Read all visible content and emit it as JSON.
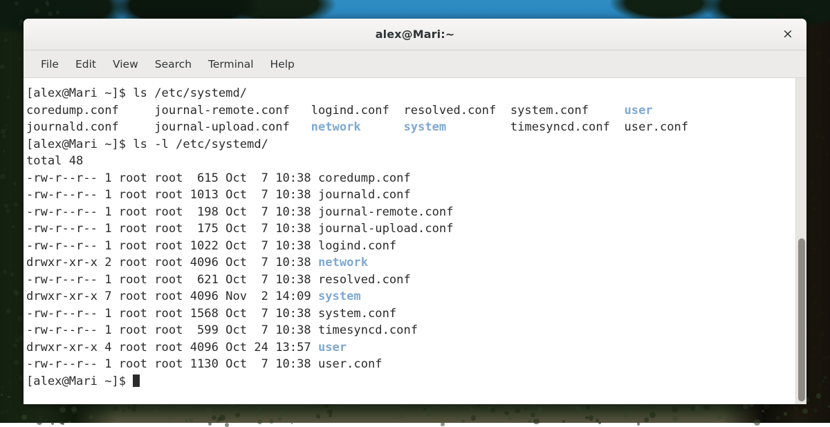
{
  "window": {
    "title": "alex@Mari:~",
    "close_label": "×"
  },
  "menubar": {
    "items": [
      {
        "label": "File"
      },
      {
        "label": "Edit"
      },
      {
        "label": "View"
      },
      {
        "label": "Search"
      },
      {
        "label": "Terminal"
      },
      {
        "label": "Help"
      }
    ]
  },
  "colors": {
    "directory_blue": "#7fa8d4",
    "foreground": "#2b2b2b",
    "background": "#ffffff",
    "titlebar": "#f1efee",
    "menubar": "#edebe9"
  },
  "terminal": {
    "prompt": "[alex@Mari ~]$ ",
    "commands": {
      "first": "ls /etc/systemd/",
      "second": "ls -l /etc/systemd/"
    },
    "ls_columns": {
      "row1": {
        "c1": "coredump.conf",
        "c2": "journal-remote.conf",
        "c3": "logind.conf",
        "c4": "resolved.conf",
        "c5": "system.conf",
        "c6": "user",
        "c6_is_dir": true
      },
      "row2": {
        "c1": "journald.conf",
        "c2": "journal-upload.conf",
        "c3": "network",
        "c3_is_dir": true,
        "c4": "system",
        "c4_is_dir": true,
        "c5": "timesyncd.conf",
        "c6": "user.conf"
      }
    },
    "total_line": "total 48",
    "long_listing": [
      {
        "perms": "-rw-r--r--",
        "links": "1",
        "owner": "root",
        "group": "root",
        "size": "615",
        "month": "Oct",
        "day": "7",
        "time": "10:38",
        "name": "coredump.conf",
        "is_dir": false
      },
      {
        "perms": "-rw-r--r--",
        "links": "1",
        "owner": "root",
        "group": "root",
        "size": "1013",
        "month": "Oct",
        "day": "7",
        "time": "10:38",
        "name": "journald.conf",
        "is_dir": false
      },
      {
        "perms": "-rw-r--r--",
        "links": "1",
        "owner": "root",
        "group": "root",
        "size": "198",
        "month": "Oct",
        "day": "7",
        "time": "10:38",
        "name": "journal-remote.conf",
        "is_dir": false
      },
      {
        "perms": "-rw-r--r--",
        "links": "1",
        "owner": "root",
        "group": "root",
        "size": "175",
        "month": "Oct",
        "day": "7",
        "time": "10:38",
        "name": "journal-upload.conf",
        "is_dir": false
      },
      {
        "perms": "-rw-r--r--",
        "links": "1",
        "owner": "root",
        "group": "root",
        "size": "1022",
        "month": "Oct",
        "day": "7",
        "time": "10:38",
        "name": "logind.conf",
        "is_dir": false
      },
      {
        "perms": "drwxr-xr-x",
        "links": "2",
        "owner": "root",
        "group": "root",
        "size": "4096",
        "month": "Oct",
        "day": "7",
        "time": "10:38",
        "name": "network",
        "is_dir": true
      },
      {
        "perms": "-rw-r--r--",
        "links": "1",
        "owner": "root",
        "group": "root",
        "size": "621",
        "month": "Oct",
        "day": "7",
        "time": "10:38",
        "name": "resolved.conf",
        "is_dir": false
      },
      {
        "perms": "drwxr-xr-x",
        "links": "7",
        "owner": "root",
        "group": "root",
        "size": "4096",
        "month": "Nov",
        "day": "2",
        "time": "14:09",
        "name": "system",
        "is_dir": true
      },
      {
        "perms": "-rw-r--r--",
        "links": "1",
        "owner": "root",
        "group": "root",
        "size": "1568",
        "month": "Oct",
        "day": "7",
        "time": "10:38",
        "name": "system.conf",
        "is_dir": false
      },
      {
        "perms": "-rw-r--r--",
        "links": "1",
        "owner": "root",
        "group": "root",
        "size": "599",
        "month": "Oct",
        "day": "7",
        "time": "10:38",
        "name": "timesyncd.conf",
        "is_dir": false
      },
      {
        "perms": "drwxr-xr-x",
        "links": "4",
        "owner": "root",
        "group": "root",
        "size": "4096",
        "month": "Oct",
        "day": "24",
        "time": "13:57",
        "name": "user",
        "is_dir": true
      },
      {
        "perms": "-rw-r--r--",
        "links": "1",
        "owner": "root",
        "group": "root",
        "size": "1130",
        "month": "Oct",
        "day": "7",
        "time": "10:38",
        "name": "user.conf",
        "is_dir": false
      }
    ]
  },
  "scrollbar": {
    "orientation": "vertical"
  }
}
